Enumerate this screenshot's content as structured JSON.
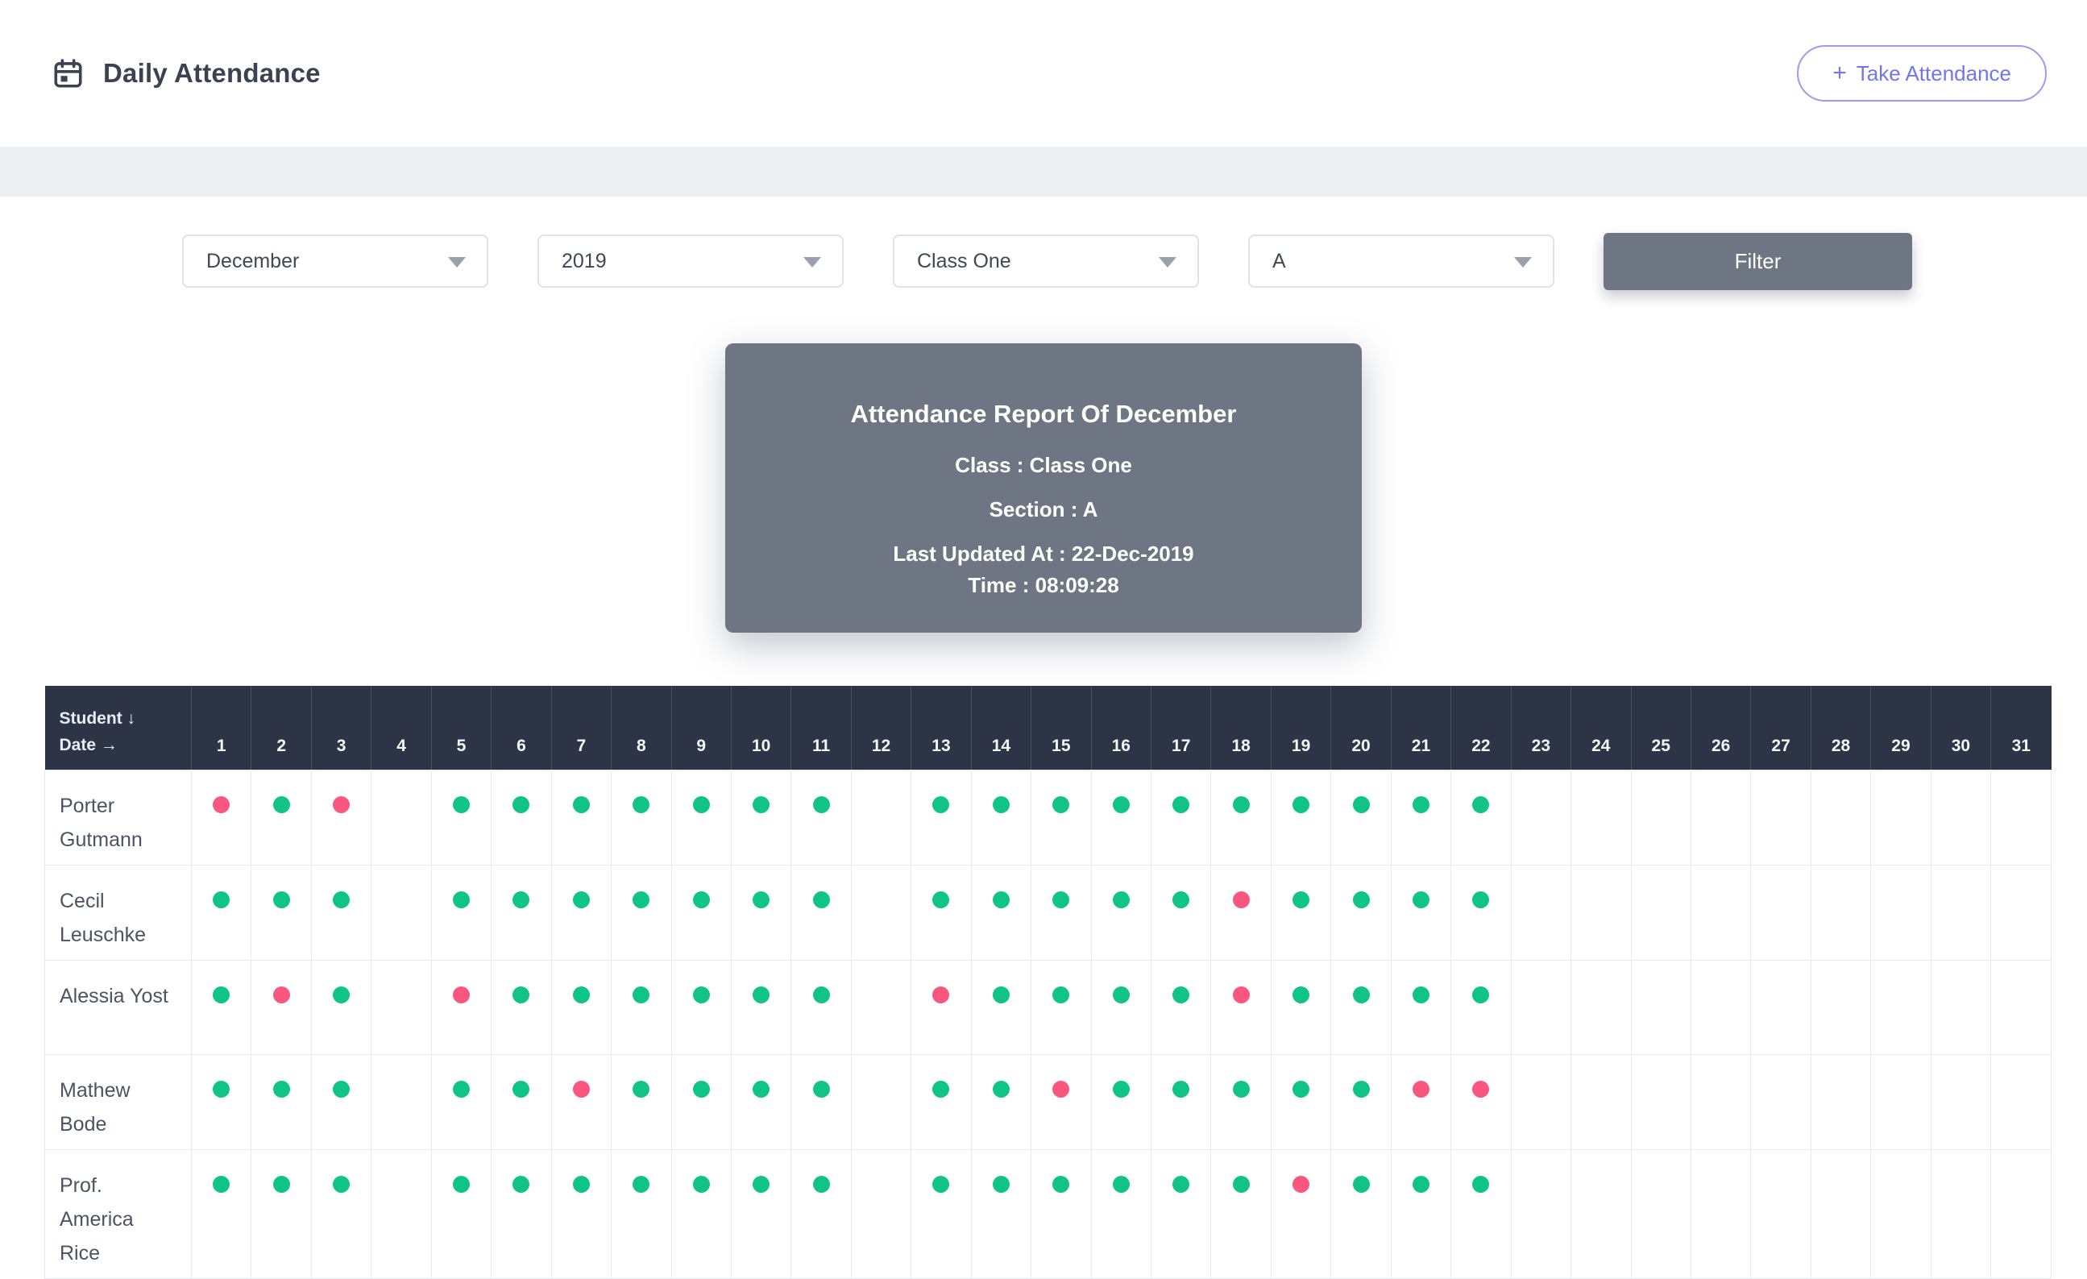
{
  "colors": {
    "accent": "#7176ef",
    "panel_gray": "#6e7583",
    "present": "#10c386",
    "absent": "#f9577f"
  },
  "header": {
    "title": "Daily Attendance",
    "take_attendance": {
      "plus_icon": "+",
      "label": "Take Attendance"
    }
  },
  "filters": {
    "month": "December",
    "year": "2019",
    "class": "Class One",
    "section": "A",
    "filter_button": "Filter"
  },
  "report_card": {
    "title": "Attendance Report Of December",
    "class_line": "Class : Class One",
    "section_line": "Section : A",
    "updated_line": "Last Updated At : 22-Dec-2019",
    "time_line": "Time : 08:09:28"
  },
  "table": {
    "corner": {
      "student_label": "Student ↓",
      "date_label": "Date →"
    },
    "days": [
      1,
      2,
      3,
      4,
      5,
      6,
      7,
      8,
      9,
      10,
      11,
      12,
      13,
      14,
      15,
      16,
      17,
      18,
      19,
      20,
      21,
      22,
      23,
      24,
      25,
      26,
      27,
      28,
      29,
      30,
      31
    ],
    "rows": [
      {
        "name": "Porter Gutmann",
        "attendance": [
          "A",
          "P",
          "A",
          "",
          "P",
          "P",
          "P",
          "P",
          "P",
          "P",
          "P",
          "",
          "P",
          "P",
          "P",
          "P",
          "P",
          "P",
          "P",
          "P",
          "P",
          "P",
          "",
          "",
          "",
          "",
          "",
          "",
          "",
          "",
          ""
        ]
      },
      {
        "name": "Cecil Leuschke",
        "attendance": [
          "P",
          "P",
          "P",
          "",
          "P",
          "P",
          "P",
          "P",
          "P",
          "P",
          "P",
          "",
          "P",
          "P",
          "P",
          "P",
          "P",
          "A",
          "P",
          "P",
          "P",
          "P",
          "",
          "",
          "",
          "",
          "",
          "",
          "",
          "",
          ""
        ]
      },
      {
        "name": "Alessia Yost",
        "attendance": [
          "P",
          "A",
          "P",
          "",
          "A",
          "P",
          "P",
          "P",
          "P",
          "P",
          "P",
          "",
          "A",
          "P",
          "P",
          "P",
          "P",
          "A",
          "P",
          "P",
          "P",
          "P",
          "",
          "",
          "",
          "",
          "",
          "",
          "",
          "",
          ""
        ]
      },
      {
        "name": "Mathew Bode",
        "attendance": [
          "P",
          "P",
          "P",
          "",
          "P",
          "P",
          "A",
          "P",
          "P",
          "P",
          "P",
          "",
          "P",
          "P",
          "A",
          "P",
          "P",
          "P",
          "P",
          "P",
          "A",
          "A",
          "",
          "",
          "",
          "",
          "",
          "",
          "",
          "",
          ""
        ]
      },
      {
        "name": "Prof. America Rice",
        "attendance": [
          "P",
          "P",
          "P",
          "",
          "P",
          "P",
          "P",
          "P",
          "P",
          "P",
          "P",
          "",
          "P",
          "P",
          "P",
          "P",
          "P",
          "P",
          "A",
          "P",
          "P",
          "P",
          "",
          "",
          "",
          "",
          "",
          "",
          "",
          "",
          ""
        ]
      }
    ]
  }
}
